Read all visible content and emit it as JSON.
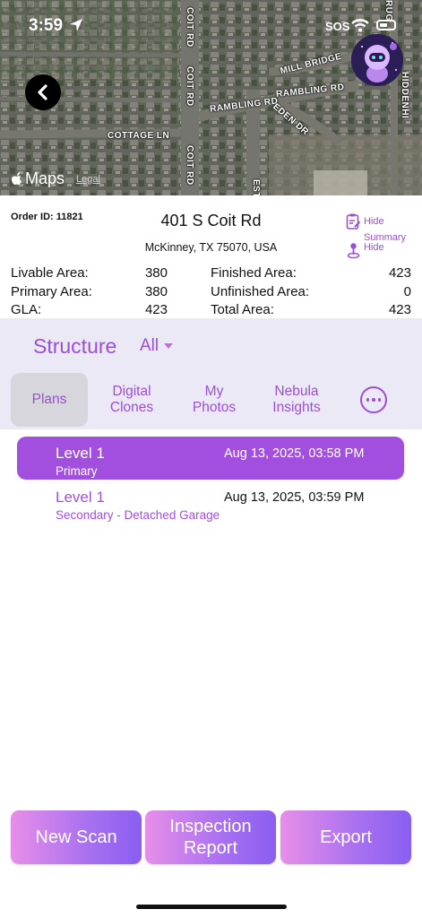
{
  "status_bar": {
    "time": "3:59",
    "sos": "SOS",
    "location_icon": "location-arrow-icon",
    "wifi_icon": "wifi-icon",
    "battery_icon": "battery-icon"
  },
  "map": {
    "attribution": "Maps",
    "legal": "Legal",
    "road_labels": [
      "COIT RD",
      "COIT RD",
      "COIT RD",
      "MILL BRIDGE",
      "RAMBLING RD",
      "RAMBLING RD",
      "EDEN DR",
      "COTTAGE LN",
      "HIDDENHI",
      "RUG",
      "EST"
    ],
    "back_icon": "chevron-left-icon",
    "avatar_icon": "robot-avatar-icon"
  },
  "order": {
    "id_label": "Order ID: 11821",
    "address": "401 S Coit Rd",
    "city": "McKinney, TX 75070, USA",
    "hide_summary_line1": "Hide",
    "hide_summary_line2": "Summary",
    "hide_location": "Hide"
  },
  "stats": {
    "left": [
      {
        "label": "Livable Area:",
        "value": "380"
      },
      {
        "label": "Primary Area:",
        "value": "380"
      },
      {
        "label": "GLA:",
        "value": "423"
      }
    ],
    "right": [
      {
        "label": "Finished Area:",
        "value": "423"
      },
      {
        "label": "Unfinished Area:",
        "value": "0"
      },
      {
        "label": "Total Area:",
        "value": "423"
      }
    ]
  },
  "structure": {
    "label": "Structure",
    "value": "All"
  },
  "tabs": [
    {
      "line1": "Plans",
      "line2": ""
    },
    {
      "line1": "Digital",
      "line2": "Clones"
    },
    {
      "line1": "My",
      "line2": "Photos"
    },
    {
      "line1": "Nebula",
      "line2": "Insights"
    }
  ],
  "plans": [
    {
      "level": "Level 1",
      "type": "Primary",
      "date": "Aug 13, 2025, 03:58 PM"
    },
    {
      "level": "Level 1",
      "type": "Secondary - Detached Garage",
      "date": "Aug 13, 2025, 03:59 PM"
    }
  ],
  "actions": {
    "new_scan": "New Scan",
    "inspection_line1": "Inspection",
    "inspection_line2": "Report",
    "export": "Export"
  },
  "colors": {
    "accent": "#a24fe0",
    "panel": "#ebe9f6",
    "tab_active": "#d7d6dc"
  }
}
